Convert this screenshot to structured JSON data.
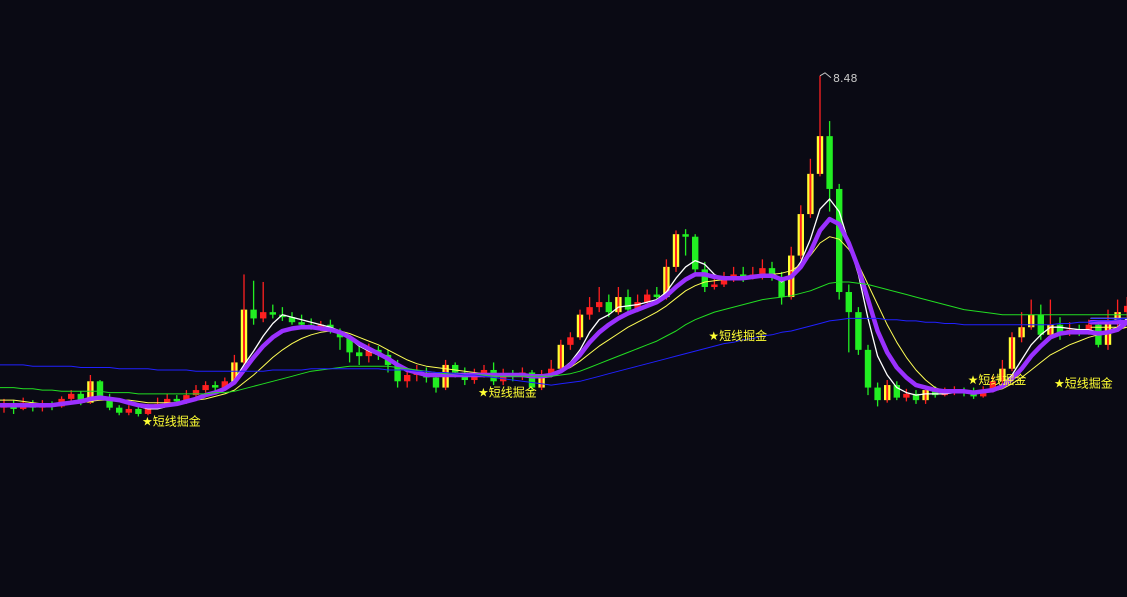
{
  "chart_data": {
    "type": "candlestick",
    "y_range": [
      5.4,
      8.55
    ],
    "colors": {
      "background": "#0a0a14",
      "up_hollow": "#ffff33",
      "up_solid": "#ff2020",
      "down": "#22ee22",
      "ma_white": "#ffffff",
      "ma_yellow": "#ffff55",
      "ma_green": "#22dd22",
      "ma_blue": "#2020ff",
      "ma_purple": "#9a30ff",
      "signal_text": "#ffff33",
      "peak_text": "#c8c8c8"
    },
    "candles": [
      [
        5.84,
        5.86,
        5.91,
        5.8
      ],
      [
        5.86,
        5.83,
        5.9,
        5.79
      ],
      [
        5.83,
        5.88,
        5.92,
        5.82
      ],
      [
        5.88,
        5.84,
        5.9,
        5.81
      ],
      [
        5.84,
        5.86,
        5.9,
        5.81
      ],
      [
        5.86,
        5.85,
        5.89,
        5.82
      ],
      [
        5.85,
        5.91,
        5.93,
        5.84
      ],
      [
        5.91,
        5.95,
        5.98,
        5.89
      ],
      [
        5.95,
        5.88,
        5.97,
        5.86
      ],
      [
        5.88,
        6.05,
        6.1,
        5.87
      ],
      [
        6.05,
        5.92,
        6.06,
        5.9
      ],
      [
        5.92,
        5.84,
        5.95,
        5.82
      ],
      [
        5.84,
        5.8,
        5.86,
        5.78
      ],
      [
        5.8,
        5.83,
        5.86,
        5.78
      ],
      [
        5.83,
        5.79,
        5.85,
        5.77
      ],
      [
        5.79,
        5.84,
        5.87,
        5.78
      ],
      [
        5.84,
        5.87,
        5.92,
        5.83
      ],
      [
        5.87,
        5.91,
        5.95,
        5.85
      ],
      [
        5.91,
        5.89,
        5.94,
        5.86
      ],
      [
        5.89,
        5.94,
        5.98,
        5.87
      ],
      [
        5.94,
        5.98,
        6.02,
        5.92
      ],
      [
        5.98,
        6.02,
        6.05,
        5.96
      ],
      [
        6.02,
        6.0,
        6.05,
        5.97
      ],
      [
        6.0,
        6.05,
        6.08,
        5.98
      ],
      [
        6.05,
        6.2,
        6.26,
        6.04
      ],
      [
        6.2,
        6.62,
        6.9,
        6.18
      ],
      [
        6.62,
        6.55,
        6.85,
        6.5
      ],
      [
        6.55,
        6.6,
        6.84,
        6.52
      ],
      [
        6.6,
        6.58,
        6.66,
        6.55
      ],
      [
        6.58,
        6.56,
        6.64,
        6.53
      ],
      [
        6.56,
        6.52,
        6.6,
        6.5
      ],
      [
        6.52,
        6.5,
        6.58,
        6.47
      ],
      [
        6.5,
        6.48,
        6.55,
        6.46
      ],
      [
        6.48,
        6.5,
        6.53,
        6.45
      ],
      [
        6.5,
        6.45,
        6.54,
        6.43
      ],
      [
        6.45,
        6.4,
        6.47,
        6.3
      ],
      [
        6.4,
        6.28,
        6.42,
        6.2
      ],
      [
        6.28,
        6.25,
        6.33,
        6.18
      ],
      [
        6.25,
        6.3,
        6.35,
        6.2
      ],
      [
        6.3,
        6.26,
        6.33,
        6.22
      ],
      [
        6.26,
        6.18,
        6.3,
        6.12
      ],
      [
        6.18,
        6.05,
        6.22,
        6.0
      ],
      [
        6.05,
        6.1,
        6.15,
        6.0
      ],
      [
        6.1,
        6.12,
        6.18,
        6.05
      ],
      [
        6.12,
        6.08,
        6.16,
        6.04
      ],
      [
        6.08,
        6.0,
        6.12,
        5.96
      ],
      [
        6.0,
        6.18,
        6.22,
        5.98
      ],
      [
        6.18,
        6.12,
        6.2,
        6.08
      ],
      [
        6.12,
        6.06,
        6.16,
        6.02
      ],
      [
        6.06,
        6.11,
        6.15,
        6.03
      ],
      [
        6.11,
        6.14,
        6.18,
        6.08
      ],
      [
        6.14,
        6.05,
        6.2,
        6.02
      ],
      [
        6.05,
        6.1,
        6.15,
        6.02
      ],
      [
        6.1,
        6.09,
        6.14,
        6.05
      ],
      [
        6.09,
        6.12,
        6.16,
        6.06
      ],
      [
        6.12,
        6.0,
        6.14,
        5.97
      ],
      [
        6.0,
        6.1,
        6.14,
        5.98
      ],
      [
        6.1,
        6.15,
        6.22,
        6.08
      ],
      [
        6.15,
        6.34,
        6.38,
        6.12
      ],
      [
        6.34,
        6.4,
        6.44,
        6.3
      ],
      [
        6.4,
        6.58,
        6.62,
        6.38
      ],
      [
        6.58,
        6.64,
        6.72,
        6.54
      ],
      [
        6.64,
        6.68,
        6.8,
        6.6
      ],
      [
        6.68,
        6.6,
        6.74,
        6.56
      ],
      [
        6.6,
        6.72,
        6.8,
        6.58
      ],
      [
        6.72,
        6.62,
        6.78,
        6.58
      ],
      [
        6.62,
        6.68,
        6.74,
        6.6
      ],
      [
        6.68,
        6.74,
        6.78,
        6.64
      ],
      [
        6.74,
        6.72,
        6.8,
        6.68
      ],
      [
        6.72,
        6.96,
        7.02,
        6.7
      ],
      [
        6.96,
        7.22,
        7.25,
        6.92
      ],
      [
        7.22,
        7.2,
        7.26,
        7.05
      ],
      [
        7.2,
        6.94,
        7.22,
        6.9
      ],
      [
        6.94,
        6.8,
        7.0,
        6.76
      ],
      [
        6.8,
        6.82,
        6.88,
        6.78
      ],
      [
        6.82,
        6.86,
        6.92,
        6.8
      ],
      [
        6.86,
        6.9,
        6.96,
        6.84
      ],
      [
        6.9,
        6.88,
        6.96,
        6.84
      ],
      [
        6.88,
        6.9,
        6.96,
        6.86
      ],
      [
        6.9,
        6.95,
        7.02,
        6.86
      ],
      [
        6.95,
        6.88,
        7.0,
        6.85
      ],
      [
        6.88,
        6.72,
        6.92,
        6.66
      ],
      [
        6.72,
        7.05,
        7.12,
        6.7
      ],
      [
        7.05,
        7.38,
        7.45,
        7.02
      ],
      [
        7.38,
        7.7,
        7.82,
        7.35
      ],
      [
        7.7,
        8.0,
        8.48,
        7.68
      ],
      [
        8.0,
        7.58,
        8.12,
        7.4
      ],
      [
        7.58,
        6.76,
        7.62,
        6.7
      ],
      [
        6.76,
        6.6,
        6.82,
        6.28
      ],
      [
        6.6,
        6.3,
        6.64,
        6.26
      ],
      [
        6.3,
        6.0,
        6.34,
        5.94
      ],
      [
        6.0,
        5.9,
        6.04,
        5.85
      ],
      [
        5.9,
        6.02,
        6.06,
        5.88
      ],
      [
        6.02,
        5.92,
        6.05,
        5.9
      ],
      [
        5.92,
        5.95,
        5.99,
        5.89
      ],
      [
        5.95,
        5.9,
        5.98,
        5.87
      ],
      [
        5.9,
        5.98,
        6.01,
        5.87
      ],
      [
        5.98,
        5.94,
        6.01,
        5.92
      ],
      [
        5.94,
        5.96,
        6.0,
        5.93
      ],
      [
        5.96,
        5.98,
        6.01,
        5.94
      ],
      [
        5.98,
        5.96,
        6.0,
        5.93
      ],
      [
        5.96,
        5.93,
        6.0,
        5.91
      ],
      [
        5.93,
        5.98,
        6.01,
        5.92
      ],
      [
        5.98,
        6.05,
        6.09,
        5.96
      ],
      [
        6.05,
        6.15,
        6.22,
        6.03
      ],
      [
        6.15,
        6.4,
        6.44,
        6.13
      ],
      [
        6.4,
        6.48,
        6.6,
        6.36
      ],
      [
        6.48,
        6.58,
        6.7,
        6.46
      ],
      [
        6.58,
        6.42,
        6.66,
        6.38
      ],
      [
        6.42,
        6.5,
        6.7,
        6.38
      ],
      [
        6.5,
        6.44,
        6.56,
        6.38
      ],
      [
        6.44,
        6.46,
        6.52,
        6.41
      ],
      [
        6.46,
        6.44,
        6.5,
        6.41
      ],
      [
        6.44,
        6.5,
        6.54,
        6.42
      ],
      [
        6.5,
        6.34,
        6.52,
        6.32
      ],
      [
        6.34,
        6.52,
        6.62,
        6.3
      ],
      [
        6.52,
        6.6,
        6.7,
        6.48
      ],
      [
        6.6,
        6.65,
        6.72,
        6.56
      ]
    ],
    "moving_averages": [
      {
        "color": "#ffffff",
        "width": 1.3,
        "values": [
          5.86,
          5.86,
          5.86,
          5.86,
          5.86,
          5.86,
          5.87,
          5.89,
          5.9,
          5.92,
          5.93,
          5.92,
          5.9,
          5.87,
          5.85,
          5.83,
          5.83,
          5.85,
          5.87,
          5.89,
          5.92,
          5.95,
          5.97,
          6.0,
          6.06,
          6.18,
          6.29,
          6.41,
          6.51,
          6.58,
          6.56,
          6.54,
          6.52,
          6.5,
          6.48,
          6.45,
          6.39,
          6.33,
          6.29,
          6.26,
          6.22,
          6.17,
          6.14,
          6.11,
          6.1,
          6.1,
          6.1,
          6.1,
          6.11,
          6.11,
          6.1,
          6.1,
          6.1,
          6.1,
          6.1,
          6.08,
          6.08,
          6.09,
          6.14,
          6.2,
          6.3,
          6.44,
          6.54,
          6.58,
          6.64,
          6.65,
          6.66,
          6.68,
          6.7,
          6.76,
          6.87,
          6.96,
          7.01,
          6.98,
          6.9,
          6.86,
          6.87,
          6.87,
          6.88,
          6.9,
          6.9,
          6.84,
          6.89,
          7.0,
          7.18,
          7.42,
          7.5,
          7.4,
          7.15,
          6.9,
          6.55,
          6.25,
          6.1,
          6.0,
          5.96,
          5.94,
          5.95,
          5.95,
          5.95,
          5.96,
          5.96,
          5.95,
          5.96,
          5.98,
          6.02,
          6.1,
          6.22,
          6.34,
          6.42,
          6.48,
          6.48,
          6.47,
          6.46,
          6.46,
          6.44,
          6.45,
          6.48,
          6.55
        ]
      },
      {
        "color": "#ffff55",
        "width": 1.0,
        "values": [
          5.9,
          5.9,
          5.89,
          5.88,
          5.87,
          5.87,
          5.87,
          5.87,
          5.88,
          5.89,
          5.9,
          5.9,
          5.9,
          5.9,
          5.89,
          5.88,
          5.88,
          5.88,
          5.88,
          5.89,
          5.9,
          5.91,
          5.93,
          5.95,
          5.98,
          6.04,
          6.1,
          6.17,
          6.24,
          6.3,
          6.35,
          6.39,
          6.42,
          6.44,
          6.45,
          6.45,
          6.43,
          6.4,
          6.37,
          6.34,
          6.3,
          6.26,
          6.22,
          6.19,
          6.17,
          6.16,
          6.15,
          6.14,
          6.13,
          6.12,
          6.11,
          6.11,
          6.1,
          6.1,
          6.1,
          6.1,
          6.1,
          6.11,
          6.13,
          6.16,
          6.21,
          6.27,
          6.33,
          6.38,
          6.43,
          6.48,
          6.52,
          6.56,
          6.6,
          6.65,
          6.71,
          6.77,
          6.81,
          6.84,
          6.85,
          6.86,
          6.86,
          6.87,
          6.88,
          6.89,
          6.9,
          6.91,
          6.93,
          6.98,
          7.05,
          7.15,
          7.2,
          7.18,
          7.1,
          6.98,
          6.82,
          6.66,
          6.5,
          6.36,
          6.24,
          6.14,
          6.06,
          6.0,
          5.97,
          5.96,
          5.96,
          5.96,
          5.96,
          5.97,
          5.99,
          6.03,
          6.08,
          6.14,
          6.2,
          6.26,
          6.3,
          6.34,
          6.37,
          6.4,
          6.42,
          6.44,
          6.46,
          6.48
        ]
      },
      {
        "color": "#9a30ff",
        "width": 4.5,
        "values": [
          5.86,
          5.86,
          5.86,
          5.86,
          5.86,
          5.86,
          5.87,
          5.88,
          5.89,
          5.91,
          5.92,
          5.91,
          5.9,
          5.88,
          5.86,
          5.85,
          5.85,
          5.86,
          5.87,
          5.89,
          5.91,
          5.94,
          5.96,
          5.99,
          6.04,
          6.14,
          6.24,
          6.33,
          6.4,
          6.45,
          6.47,
          6.48,
          6.48,
          6.47,
          6.46,
          6.44,
          6.4,
          6.35,
          6.31,
          6.27,
          6.23,
          6.18,
          6.14,
          6.12,
          6.1,
          6.1,
          6.1,
          6.1,
          6.1,
          6.1,
          6.1,
          6.1,
          6.1,
          6.1,
          6.1,
          6.09,
          6.09,
          6.1,
          6.13,
          6.18,
          6.26,
          6.36,
          6.44,
          6.5,
          6.55,
          6.59,
          6.62,
          6.65,
          6.68,
          6.73,
          6.8,
          6.86,
          6.9,
          6.9,
          6.88,
          6.87,
          6.87,
          6.87,
          6.88,
          6.89,
          6.89,
          6.86,
          6.88,
          6.96,
          7.08,
          7.25,
          7.34,
          7.3,
          7.15,
          6.95,
          6.7,
          6.45,
          6.28,
          6.16,
          6.08,
          6.02,
          6.0,
          5.98,
          5.97,
          5.97,
          5.97,
          5.96,
          5.97,
          5.98,
          6.01,
          6.07,
          6.15,
          6.25,
          6.33,
          6.4,
          6.43,
          6.44,
          6.44,
          6.44,
          6.43,
          6.44,
          6.46,
          6.52
        ]
      },
      {
        "color": "#22dd22",
        "width": 1.0,
        "values": [
          6.0,
          6.0,
          5.99,
          5.99,
          5.98,
          5.98,
          5.97,
          5.97,
          5.97,
          5.97,
          5.97,
          5.96,
          5.96,
          5.96,
          5.95,
          5.95,
          5.95,
          5.95,
          5.95,
          5.95,
          5.95,
          5.95,
          5.96,
          5.96,
          5.97,
          5.99,
          6.01,
          6.03,
          6.05,
          6.07,
          6.09,
          6.11,
          6.13,
          6.14,
          6.15,
          6.16,
          6.17,
          6.17,
          6.17,
          6.17,
          6.17,
          6.16,
          6.15,
          6.14,
          6.13,
          6.12,
          6.11,
          6.11,
          6.1,
          6.1,
          6.1,
          6.09,
          6.09,
          6.09,
          6.09,
          6.09,
          6.09,
          6.09,
          6.1,
          6.11,
          6.13,
          6.16,
          6.19,
          6.22,
          6.25,
          6.28,
          6.31,
          6.34,
          6.37,
          6.41,
          6.45,
          6.5,
          6.54,
          6.57,
          6.6,
          6.62,
          6.64,
          6.66,
          6.68,
          6.7,
          6.71,
          6.72,
          6.73,
          6.75,
          6.77,
          6.8,
          6.83,
          6.84,
          6.84,
          6.83,
          6.82,
          6.8,
          6.78,
          6.76,
          6.74,
          6.72,
          6.7,
          6.68,
          6.66,
          6.64,
          6.62,
          6.61,
          6.6,
          6.59,
          6.58,
          6.58,
          6.58,
          6.58,
          6.58,
          6.58,
          6.58,
          6.58,
          6.58,
          6.58,
          6.58,
          6.58,
          6.58,
          6.58
        ]
      },
      {
        "color": "#2020ff",
        "width": 1.0,
        "values": [
          6.18,
          6.18,
          6.18,
          6.17,
          6.17,
          6.17,
          6.17,
          6.17,
          6.16,
          6.16,
          6.16,
          6.16,
          6.15,
          6.15,
          6.15,
          6.15,
          6.14,
          6.14,
          6.14,
          6.14,
          6.13,
          6.13,
          6.13,
          6.13,
          6.13,
          6.13,
          6.13,
          6.13,
          6.14,
          6.14,
          6.14,
          6.14,
          6.15,
          6.15,
          6.15,
          6.15,
          6.15,
          6.15,
          6.15,
          6.15,
          6.14,
          6.14,
          6.14,
          6.13,
          6.13,
          6.12,
          6.12,
          6.11,
          6.1,
          6.1,
          6.09,
          6.08,
          6.07,
          6.06,
          6.05,
          6.04,
          6.03,
          6.02,
          6.03,
          6.04,
          6.05,
          6.07,
          6.09,
          6.11,
          6.13,
          6.15,
          6.17,
          6.19,
          6.21,
          6.23,
          6.25,
          6.27,
          6.29,
          6.31,
          6.33,
          6.35,
          6.36,
          6.38,
          6.39,
          6.41,
          6.42,
          6.44,
          6.45,
          6.47,
          6.49,
          6.51,
          6.53,
          6.54,
          6.55,
          6.55,
          6.55,
          6.55,
          6.54,
          6.54,
          6.53,
          6.53,
          6.52,
          6.52,
          6.51,
          6.51,
          6.5,
          6.5,
          6.5,
          6.5,
          6.5,
          6.5,
          6.5,
          6.5,
          6.5,
          6.5,
          6.51,
          6.51,
          6.52,
          6.52,
          6.53,
          6.53,
          6.54,
          6.55
        ]
      }
    ],
    "signals": [
      {
        "index": 15,
        "y": 5.7,
        "text": "★短线掘金"
      },
      {
        "index": 50,
        "y": 5.93,
        "text": "★短线掘金"
      },
      {
        "index": 74,
        "y": 6.38,
        "text": "★短线掘金"
      },
      {
        "index": 101,
        "y": 6.03,
        "text": "★短线掘金"
      },
      {
        "index": 110,
        "y": 6.0,
        "text": "★短线掘金"
      }
    ],
    "peak_marker": {
      "index": 85,
      "value": 8.48,
      "text": "8.48"
    }
  }
}
